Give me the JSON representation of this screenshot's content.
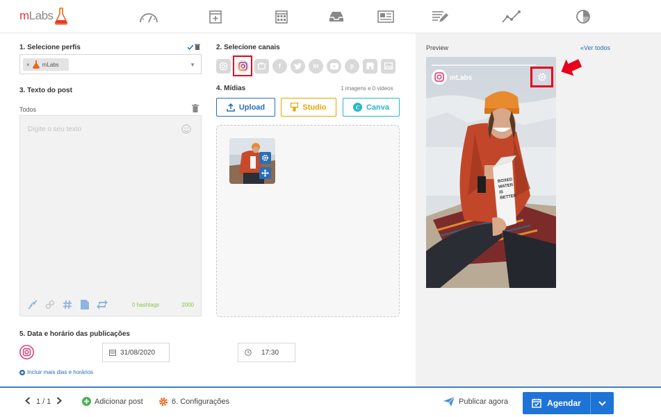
{
  "brand": {
    "logo_text_main": "m",
    "logo_text_rest": "Labs"
  },
  "nav": {
    "items": [
      {
        "name": "dashboard-icon"
      },
      {
        "name": "calendar-add-icon"
      },
      {
        "name": "calendar-icon"
      },
      {
        "name": "inbox-icon"
      },
      {
        "name": "news-icon"
      },
      {
        "name": "edit-list-icon"
      },
      {
        "name": "analytics-icon"
      },
      {
        "name": "pie-chart-icon"
      }
    ]
  },
  "profiles": {
    "label": "1. Selecione perfis",
    "chip_label": "mLabs",
    "chip_remove": "×"
  },
  "post_text": {
    "label": "3. Texto do post",
    "tab_all": "Todos",
    "placeholder": "Digite o seu texto",
    "hashtags": "0 hashtags",
    "char_count": "2000"
  },
  "channels": {
    "label": "2. Selecione canais"
  },
  "media": {
    "label": "4. Mídias",
    "count": "1 imagens e 0 videos",
    "upload_label": "Upload",
    "studio_label": "Studio",
    "canva_label": "Canva"
  },
  "schedule": {
    "label": "5. Data e horário das publicações",
    "date": "31/08/2020",
    "time": "17:30",
    "include_more": "Incluir mais dias e horários"
  },
  "preview": {
    "label": "Preview",
    "see_all": "Ver todos",
    "account_name": "mLabs"
  },
  "footer": {
    "pager": "1 / 1",
    "add_post": "Adicionar post",
    "settings": "6. Configurações",
    "publish_now": "Publicar agora",
    "schedule": "Agendar"
  },
  "colors": {
    "accent": "#1e74d6",
    "brand_red": "#e53935",
    "highlight": "#e8001c",
    "orange": "#e86a1e"
  }
}
